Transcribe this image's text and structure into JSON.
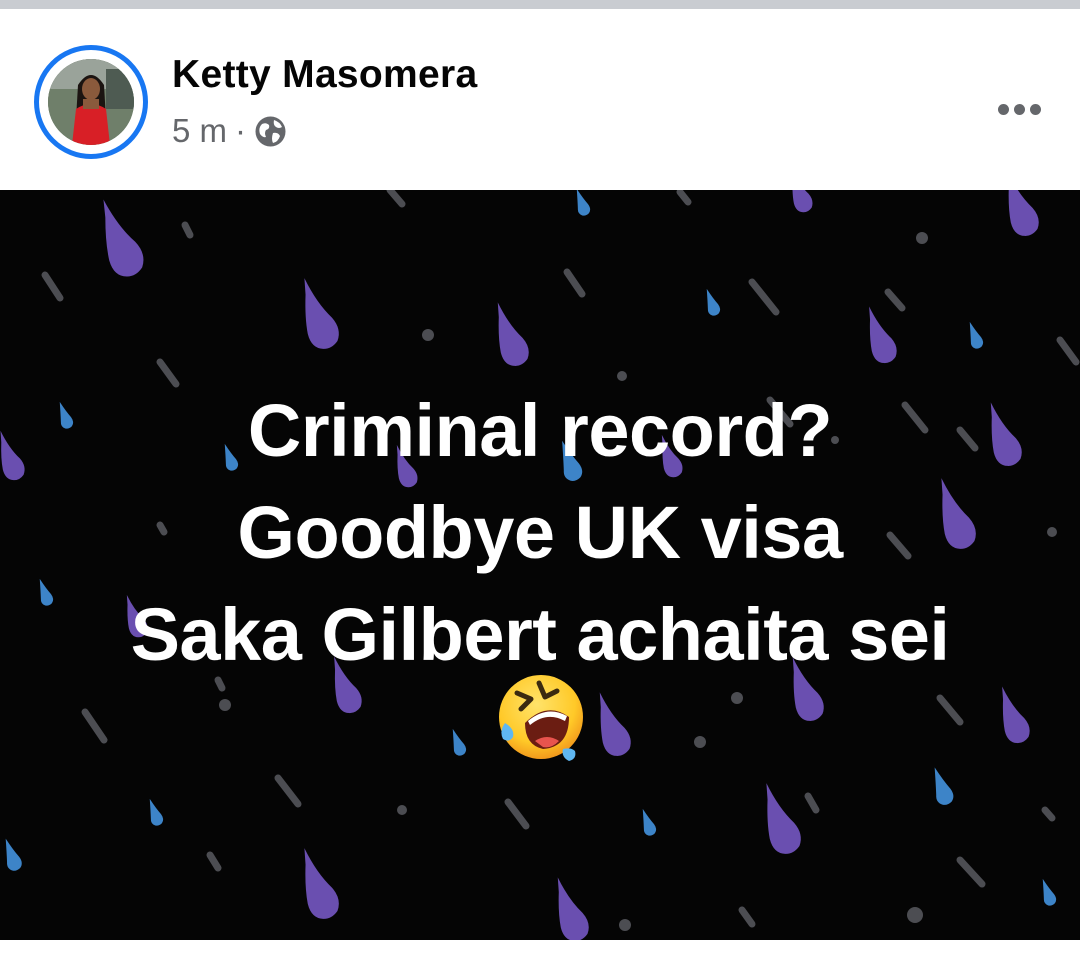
{
  "post": {
    "author": "Ketty Masomera",
    "time": "5 m",
    "separator": "·",
    "audience_icon": "globe-icon",
    "more_icon": "more-options-icon",
    "text_lines": [
      "Criminal record?",
      "Goodbye UK visa",
      "Saka Gilbert achaita sei"
    ],
    "emoji": "rolling-on-floor-laughing-emoji",
    "background_color": "#050505"
  },
  "colors": {
    "avatar_ring": "#1877f2",
    "author_text": "#050505",
    "meta_text": "#65676b",
    "raindrop_purple": "#6c4fb4",
    "raindrop_blue": "#3f86c9",
    "raindrop_gray": "#4f5055"
  }
}
